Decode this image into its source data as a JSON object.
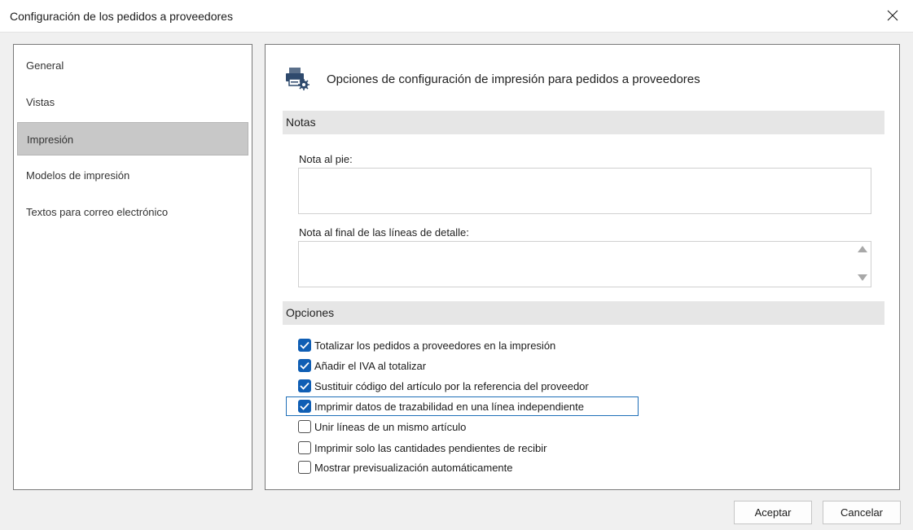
{
  "window": {
    "title": "Configuración de los pedidos a proveedores",
    "close_icon": "close-icon"
  },
  "nav": {
    "items": [
      {
        "label": "General",
        "selected": false
      },
      {
        "label": "Vistas",
        "selected": false
      },
      {
        "label": "Impresión",
        "selected": true
      },
      {
        "label": "Modelos de impresión",
        "selected": false
      },
      {
        "label": "Textos para correo electrónico",
        "selected": false
      }
    ]
  },
  "content": {
    "header_icon": "printer-settings-icon",
    "header": "Opciones de configuración de impresión para pedidos a proveedores",
    "notes_section": "Notas",
    "footer_note_label": "Nota al pie:",
    "footer_note_value": "",
    "detail_note_label": "Nota al final de las líneas de detalle:",
    "detail_note_value": "",
    "options_section": "Opciones",
    "options": [
      {
        "label": "Totalizar los pedidos a proveedores en la impresión",
        "checked": true
      },
      {
        "label": "Añadir el IVA al totalizar",
        "checked": true
      },
      {
        "label": "Sustituir código del artículo por la referencia del proveedor",
        "checked": true
      },
      {
        "label": "Imprimir datos de trazabilidad en una línea independiente",
        "checked": true
      },
      {
        "label": "Unir líneas de un mismo artículo",
        "checked": false
      },
      {
        "label": "Imprimir solo las cantidades pendientes de recibir",
        "checked": false
      },
      {
        "label": "Mostrar previsualización automáticamente",
        "checked": false
      }
    ]
  },
  "buttons": {
    "accept": "Aceptar",
    "cancel": "Cancelar"
  },
  "colors": {
    "accent": "#0f5eb4",
    "focus": "#1f6fb8",
    "selected_nav": "#c8c8c8"
  }
}
